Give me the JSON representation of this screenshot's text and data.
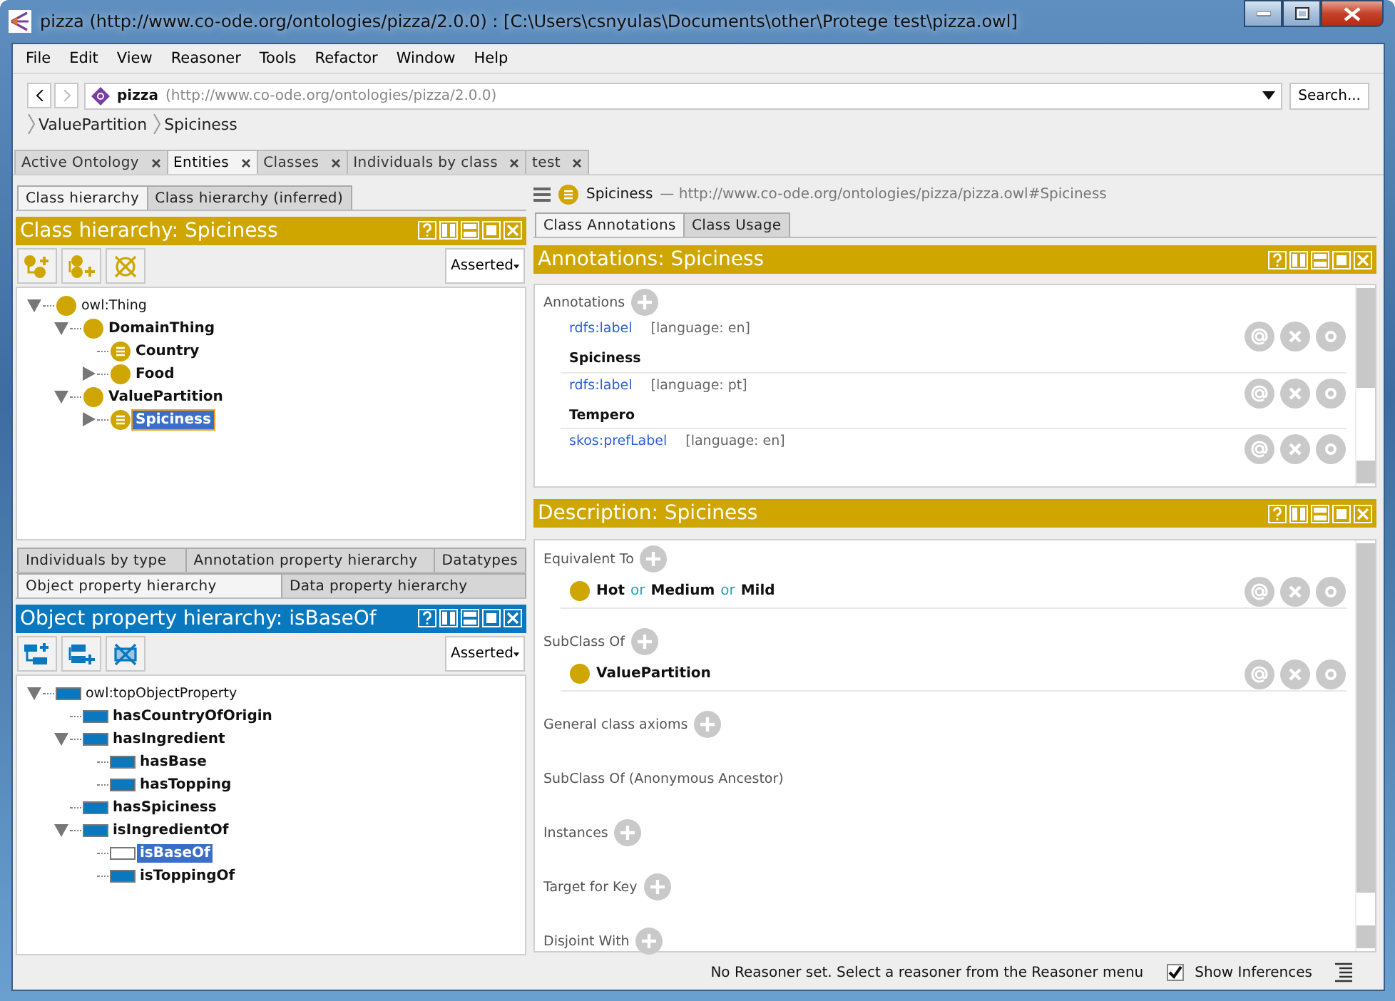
{
  "window": {
    "title": "pizza (http://www.co-ode.org/ontologies/pizza/2.0.0)  : [C:\\Users\\csnyulas\\Documents\\other\\Protege test\\pizza.owl]"
  },
  "menu": [
    "File",
    "Edit",
    "View",
    "Reasoner",
    "Tools",
    "Refactor",
    "Window",
    "Help"
  ],
  "nav": {
    "ontology": "pizza",
    "iri": "(http://www.co-ode.org/ontologies/pizza/2.0.0)",
    "search": "Search..."
  },
  "breadcrumb": [
    "ValuePartition",
    "Spiciness"
  ],
  "tabs": [
    {
      "label": "Active Ontology",
      "selected": false
    },
    {
      "label": "Entities",
      "selected": true
    },
    {
      "label": "Classes",
      "selected": false
    },
    {
      "label": "Individuals by class",
      "selected": false
    },
    {
      "label": "test",
      "selected": false
    }
  ],
  "class_tabs": [
    {
      "label": "Class hierarchy",
      "selected": true
    },
    {
      "label": "Class hierarchy (inferred)",
      "selected": false
    }
  ],
  "class_panel": {
    "title": "Class hierarchy: Spiciness",
    "mode": "Asserted",
    "tree": [
      {
        "label": "owl:Thing",
        "kind": "thing",
        "expandable": true,
        "expanded": true,
        "selected": false,
        "children": [
          {
            "label": "DomainThing",
            "kind": "class",
            "expandable": true,
            "expanded": true,
            "selected": false,
            "children": [
              {
                "label": "Country",
                "kind": "defined",
                "expandable": false,
                "selected": false
              },
              {
                "label": "Food",
                "kind": "class",
                "expandable": true,
                "expanded": false,
                "selected": false
              }
            ]
          },
          {
            "label": "ValuePartition",
            "kind": "class",
            "expandable": true,
            "expanded": true,
            "selected": false,
            "children": [
              {
                "label": "Spiciness",
                "kind": "defined",
                "expandable": true,
                "expanded": false,
                "selected": true
              }
            ]
          }
        ]
      }
    ]
  },
  "property_tab_rows": [
    [
      {
        "label": "Individuals by type",
        "selected": false
      },
      {
        "label": "Annotation property hierarchy",
        "selected": false
      },
      {
        "label": "Datatypes",
        "selected": false
      }
    ],
    [
      {
        "label": "Object property hierarchy",
        "selected": true
      },
      {
        "label": "Data property hierarchy",
        "selected": false
      }
    ]
  ],
  "property_panel": {
    "title": "Object property hierarchy: isBaseOf",
    "mode": "Asserted",
    "tree": [
      {
        "label": "owl:topObjectProperty",
        "kind": "top-property",
        "expandable": true,
        "expanded": true,
        "selected": false,
        "children": [
          {
            "label": "hasCountryOfOrigin",
            "kind": "property",
            "expandable": false,
            "selected": false
          },
          {
            "label": "hasIngredient",
            "kind": "property",
            "expandable": true,
            "expanded": true,
            "selected": false,
            "children": [
              {
                "label": "hasBase",
                "kind": "property",
                "expandable": false,
                "selected": false
              },
              {
                "label": "hasTopping",
                "kind": "property",
                "expandable": false,
                "selected": false
              }
            ]
          },
          {
            "label": "hasSpiciness",
            "kind": "property",
            "expandable": false,
            "selected": false
          },
          {
            "label": "isIngredientOf",
            "kind": "property",
            "expandable": true,
            "expanded": true,
            "selected": false,
            "children": [
              {
                "label": "isBaseOf",
                "kind": "property",
                "expandable": false,
                "selected": true
              },
              {
                "label": "isToppingOf",
                "kind": "property",
                "expandable": false,
                "selected": false
              }
            ]
          }
        ]
      }
    ]
  },
  "entity": {
    "name": "Spiciness",
    "iri": "— http://www.co-ode.org/ontologies/pizza/pizza.owl#Spiciness"
  },
  "entity_tabs": [
    {
      "label": "Class Annotations",
      "selected": true
    },
    {
      "label": "Class Usage",
      "selected": false
    }
  ],
  "annotations_panel": {
    "title": "Annotations: Spiciness",
    "heading": "Annotations",
    "items": [
      {
        "property": "rdfs:label",
        "language": "[language: en]",
        "value": "Spiciness"
      },
      {
        "property": "rdfs:label",
        "language": "[language: pt]",
        "value": "Tempero"
      },
      {
        "property": "skos:prefLabel",
        "language": "[language: en]"
      }
    ]
  },
  "description_panel": {
    "title": "Description: Spiciness",
    "sections": [
      {
        "label": "Equivalent To",
        "addable": true,
        "items": [
          [
            {
              "text": "Hot",
              "kind": "class"
            },
            {
              "text": "or",
              "kind": "keyword"
            },
            {
              "text": "Medium",
              "kind": "class"
            },
            {
              "text": "or",
              "kind": "keyword"
            },
            {
              "text": "Mild",
              "kind": "class"
            }
          ]
        ]
      },
      {
        "label": "SubClass Of",
        "addable": true,
        "items": [
          [
            {
              "text": "ValuePartition",
              "kind": "class"
            }
          ]
        ]
      },
      {
        "label": "General class axioms",
        "addable": true
      },
      {
        "label": "SubClass Of (Anonymous Ancestor)",
        "addable": false
      },
      {
        "label": "Instances",
        "addable": true
      },
      {
        "label": "Target for Key",
        "addable": true
      },
      {
        "label": "Disjoint With",
        "addable": true
      }
    ]
  },
  "status_bar": {
    "message": "No Reasoner set. Select a reasoner from the Reasoner menu",
    "show_inferences": {
      "label": "Show Inferences",
      "checked": true
    }
  }
}
